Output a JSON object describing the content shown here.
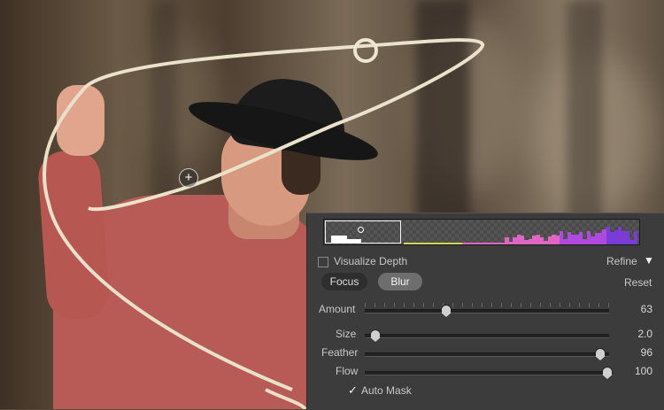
{
  "photo": {
    "icon": "cowboy-roping-photo"
  },
  "focus_cursor": {
    "glyph": "+"
  },
  "panel": {
    "histogram_colors": [
      "#ffffff",
      "#d8d44a",
      "#e066c4",
      "#b04adf",
      "#7a3bd6"
    ],
    "visualize_depth": {
      "label": "Visualize Depth",
      "checked": false
    },
    "refine": {
      "label": "Refine",
      "arrow": "▼"
    },
    "modes": {
      "focus": "Focus",
      "blur": "Blur",
      "active": "Blur"
    },
    "reset": "Reset",
    "sliders": [
      {
        "label": "Amount",
        "value": "63",
        "fraction": 0.33
      },
      {
        "label": "Size",
        "value": "2.0",
        "fraction": 0.04
      },
      {
        "label": "Feather",
        "value": "96",
        "fraction": 0.96
      },
      {
        "label": "Flow",
        "value": "100",
        "fraction": 0.99
      }
    ],
    "auto_mask": {
      "label": "Auto Mask",
      "checked": true,
      "glyph": "✓"
    }
  }
}
